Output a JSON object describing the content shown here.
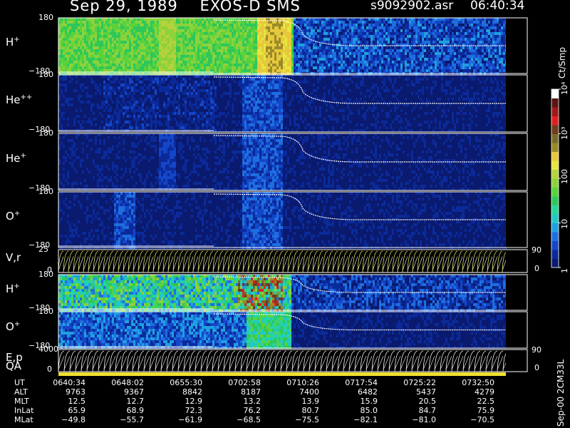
{
  "header": {
    "title": "Sep 29, 1989    EXOS-D SMS",
    "file": "s9092902.asr",
    "time": "06:40:34"
  },
  "panels": [
    {
      "label": "H",
      "sup": "+",
      "ymax": "180",
      "ymin": "−180"
    },
    {
      "label": "He",
      "sup": "++",
      "ymax": "180",
      "ymin": "−180"
    },
    {
      "label": "He",
      "sup": "+",
      "ymax": "180",
      "ymin": "−180"
    },
    {
      "label": "O",
      "sup": "+",
      "ymax": "180",
      "ymin": "−180"
    },
    {
      "label": "V,r",
      "sup": "",
      "ymax": "25",
      "ymin": "0",
      "rmax": "90",
      "rmin": "0"
    },
    {
      "label": "H",
      "sup": "+",
      "ymax": "180",
      "ymin": "−180"
    },
    {
      "label": "O",
      "sup": "+",
      "ymax": "180",
      "ymin": "−180"
    },
    {
      "label": "E,p",
      "sup": "",
      "ymax": "4000",
      "ymin": "0",
      "rmax": "90",
      "rmin": "0",
      "label2": "QA"
    }
  ],
  "colorbar": {
    "unit": "Ct/Smp",
    "ticks": [
      "1",
      "10",
      "100",
      "10³",
      "10⁴"
    ],
    "colors": [
      "#0a1a6e",
      "#0b2a9a",
      "#1446c8",
      "#1e6ee0",
      "#1fa0e0",
      "#22c8c8",
      "#26d69a",
      "#2ec85a",
      "#5ad23c",
      "#8cd23c",
      "#b4d23c",
      "#e6e63c",
      "#e6c83c",
      "#9a8a2a",
      "#7a6a2a",
      "#6e3c1e",
      "#e02020",
      "#a01818",
      "#5a1414",
      "#ffffff"
    ]
  },
  "chart_data": {
    "type": "heatmap",
    "title": "Sep 29, 1989    EXOS-D SMS",
    "xlabel": "UT",
    "x_ticks": [
      "0640:34",
      "0648:02",
      "0655:30",
      "0702:58",
      "0710:26",
      "0717:54",
      "0725:22",
      "0732:50"
    ],
    "ephemeris": [
      {
        "name": "UT",
        "values": [
          "0640:34",
          "0648:02",
          "0655:30",
          "0702:58",
          "0710:26",
          "0717:54",
          "0725:22",
          "0732:50"
        ]
      },
      {
        "name": "ALT",
        "values": [
          "9763",
          "9367",
          "8842",
          "8187",
          "7400",
          "6482",
          "5437",
          "4279"
        ]
      },
      {
        "name": "MLT",
        "values": [
          "12.5",
          "12.7",
          "12.9",
          "13.2",
          "13.9",
          "15.9",
          "20.5",
          "22.5"
        ]
      },
      {
        "name": "InLat",
        "values": [
          "65.9",
          "68.9",
          "72.3",
          "76.2",
          "80.7",
          "85.0",
          "84.7",
          "75.9"
        ]
      },
      {
        "name": "MLat",
        "values": [
          "−49.8",
          "−55.7",
          "−61.9",
          "−68.5",
          "−75.5",
          "−82.1",
          "−81.0",
          "−70.5"
        ]
      }
    ],
    "series": [
      {
        "name": "H+"
      },
      {
        "name": "He++"
      },
      {
        "name": "He+"
      },
      {
        "name": "O+"
      },
      {
        "name": "V,r"
      },
      {
        "name": "H+"
      },
      {
        "name": "O+"
      },
      {
        "name": "E,p"
      }
    ],
    "colorbar_scale": "log",
    "colorbar_range": [
      1,
      10000
    ],
    "grid": false
  }
}
